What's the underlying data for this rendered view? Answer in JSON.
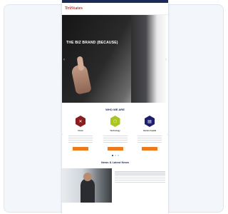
{
  "site": {
    "logo": "TriStates",
    "topbar_links": [
      "",
      "",
      ""
    ],
    "nav": [
      "",
      "",
      "",
      ""
    ],
    "hero": {
      "title": "THE BIZ BRAND (BECAUSE)",
      "subtitle": ""
    },
    "services_title": "WHO WE ARE",
    "services": [
      {
        "name": "Vision",
        "button": "",
        "color": "#8b1d1d",
        "icon": "badge-icon"
      },
      {
        "name": "Technology",
        "button": "",
        "color": "#a8c520",
        "icon": "hex-icon"
      },
      {
        "name": "Human Capital",
        "button": "",
        "color": "#1e1e6e",
        "icon": "doc-icon"
      }
    ],
    "news_title": "News & Latest News",
    "news": {
      "headline": "",
      "date": ""
    }
  }
}
